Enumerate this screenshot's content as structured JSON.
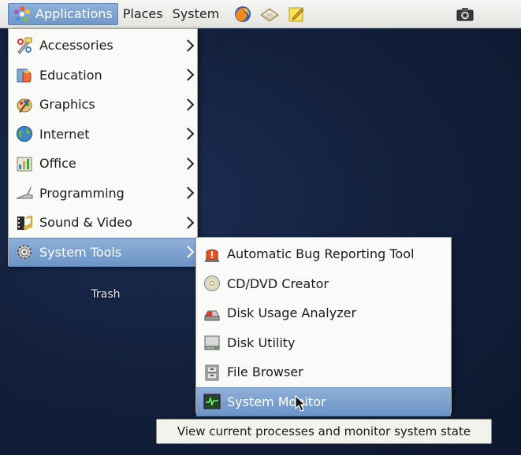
{
  "panel": {
    "menus": [
      {
        "label": "Applications",
        "active": true
      },
      {
        "label": "Places",
        "active": false
      },
      {
        "label": "System",
        "active": false
      }
    ],
    "launchers": [
      "firefox-icon",
      "mail-icon",
      "notes-icon"
    ],
    "right_icons": [
      "screenshot-icon"
    ]
  },
  "desktop": {
    "trash_label": "Trash"
  },
  "applications_menu": {
    "items": [
      {
        "label": "Accessories",
        "icon": "accessories-icon",
        "submenu": true,
        "selected": false
      },
      {
        "label": "Education",
        "icon": "education-icon",
        "submenu": true,
        "selected": false
      },
      {
        "label": "Graphics",
        "icon": "graphics-icon",
        "submenu": true,
        "selected": false
      },
      {
        "label": "Internet",
        "icon": "internet-globe-icon",
        "submenu": true,
        "selected": false
      },
      {
        "label": "Office",
        "icon": "office-icon",
        "submenu": true,
        "selected": false
      },
      {
        "label": "Programming",
        "icon": "programming-icon",
        "submenu": true,
        "selected": false
      },
      {
        "label": "Sound & Video",
        "icon": "sound-video-icon",
        "submenu": true,
        "selected": false
      },
      {
        "label": "System Tools",
        "icon": "system-tools-gear-icon",
        "submenu": true,
        "selected": true
      }
    ]
  },
  "system_tools_menu": {
    "items": [
      {
        "label": "Automatic Bug Reporting Tool",
        "icon": "alarm-icon",
        "selected": false
      },
      {
        "label": "CD/DVD Creator",
        "icon": "cd-dvd-icon",
        "selected": false
      },
      {
        "label": "Disk Usage Analyzer",
        "icon": "disk-usage-icon",
        "selected": false
      },
      {
        "label": "Disk Utility",
        "icon": "disk-utility-icon",
        "selected": false
      },
      {
        "label": "File Browser",
        "icon": "file-cabinet-icon",
        "selected": false
      },
      {
        "label": "System Monitor",
        "icon": "system-monitor-icon",
        "selected": true
      }
    ]
  },
  "tooltip": {
    "text": "View current processes and monitor system state"
  },
  "colors": {
    "selection": "#7aa0cf",
    "panel": "#ececea",
    "menu_bg": "#fafaf8",
    "desktop": "#13213e"
  }
}
